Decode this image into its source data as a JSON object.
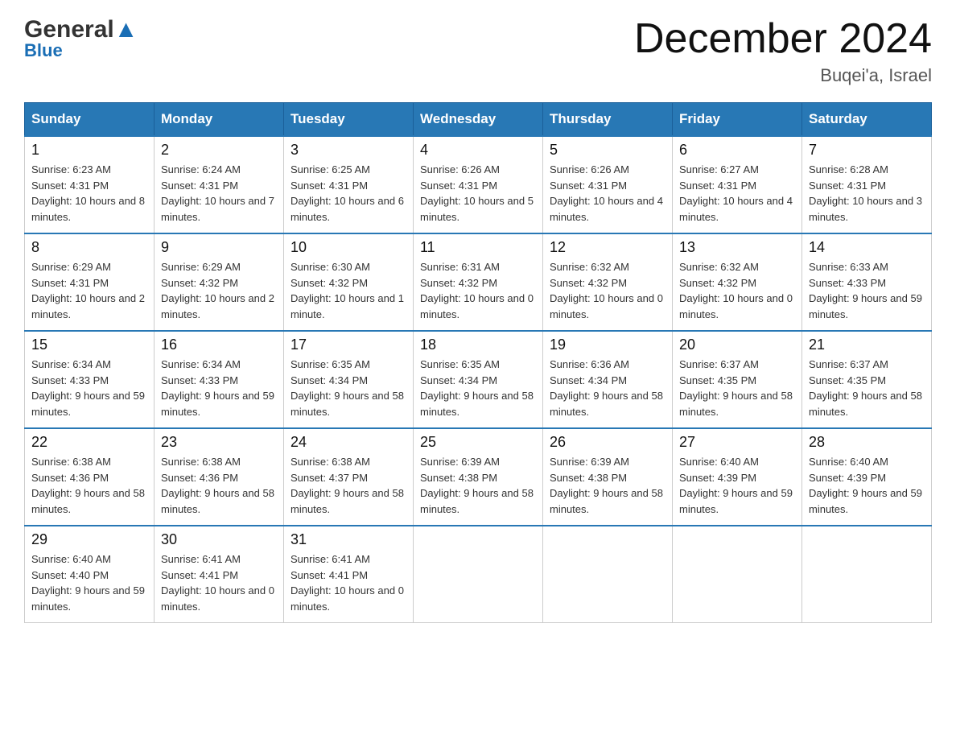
{
  "header": {
    "logo_general": "General",
    "logo_blue": "Blue",
    "title": "December 2024",
    "location": "Buqei'a, Israel"
  },
  "calendar": {
    "days_of_week": [
      "Sunday",
      "Monday",
      "Tuesday",
      "Wednesday",
      "Thursday",
      "Friday",
      "Saturday"
    ],
    "weeks": [
      [
        {
          "date": "1",
          "sunrise": "6:23 AM",
          "sunset": "4:31 PM",
          "daylight": "10 hours and 8 minutes."
        },
        {
          "date": "2",
          "sunrise": "6:24 AM",
          "sunset": "4:31 PM",
          "daylight": "10 hours and 7 minutes."
        },
        {
          "date": "3",
          "sunrise": "6:25 AM",
          "sunset": "4:31 PM",
          "daylight": "10 hours and 6 minutes."
        },
        {
          "date": "4",
          "sunrise": "6:26 AM",
          "sunset": "4:31 PM",
          "daylight": "10 hours and 5 minutes."
        },
        {
          "date": "5",
          "sunrise": "6:26 AM",
          "sunset": "4:31 PM",
          "daylight": "10 hours and 4 minutes."
        },
        {
          "date": "6",
          "sunrise": "6:27 AM",
          "sunset": "4:31 PM",
          "daylight": "10 hours and 4 minutes."
        },
        {
          "date": "7",
          "sunrise": "6:28 AM",
          "sunset": "4:31 PM",
          "daylight": "10 hours and 3 minutes."
        }
      ],
      [
        {
          "date": "8",
          "sunrise": "6:29 AM",
          "sunset": "4:31 PM",
          "daylight": "10 hours and 2 minutes."
        },
        {
          "date": "9",
          "sunrise": "6:29 AM",
          "sunset": "4:32 PM",
          "daylight": "10 hours and 2 minutes."
        },
        {
          "date": "10",
          "sunrise": "6:30 AM",
          "sunset": "4:32 PM",
          "daylight": "10 hours and 1 minute."
        },
        {
          "date": "11",
          "sunrise": "6:31 AM",
          "sunset": "4:32 PM",
          "daylight": "10 hours and 0 minutes."
        },
        {
          "date": "12",
          "sunrise": "6:32 AM",
          "sunset": "4:32 PM",
          "daylight": "10 hours and 0 minutes."
        },
        {
          "date": "13",
          "sunrise": "6:32 AM",
          "sunset": "4:32 PM",
          "daylight": "10 hours and 0 minutes."
        },
        {
          "date": "14",
          "sunrise": "6:33 AM",
          "sunset": "4:33 PM",
          "daylight": "9 hours and 59 minutes."
        }
      ],
      [
        {
          "date": "15",
          "sunrise": "6:34 AM",
          "sunset": "4:33 PM",
          "daylight": "9 hours and 59 minutes."
        },
        {
          "date": "16",
          "sunrise": "6:34 AM",
          "sunset": "4:33 PM",
          "daylight": "9 hours and 59 minutes."
        },
        {
          "date": "17",
          "sunrise": "6:35 AM",
          "sunset": "4:34 PM",
          "daylight": "9 hours and 58 minutes."
        },
        {
          "date": "18",
          "sunrise": "6:35 AM",
          "sunset": "4:34 PM",
          "daylight": "9 hours and 58 minutes."
        },
        {
          "date": "19",
          "sunrise": "6:36 AM",
          "sunset": "4:34 PM",
          "daylight": "9 hours and 58 minutes."
        },
        {
          "date": "20",
          "sunrise": "6:37 AM",
          "sunset": "4:35 PM",
          "daylight": "9 hours and 58 minutes."
        },
        {
          "date": "21",
          "sunrise": "6:37 AM",
          "sunset": "4:35 PM",
          "daylight": "9 hours and 58 minutes."
        }
      ],
      [
        {
          "date": "22",
          "sunrise": "6:38 AM",
          "sunset": "4:36 PM",
          "daylight": "9 hours and 58 minutes."
        },
        {
          "date": "23",
          "sunrise": "6:38 AM",
          "sunset": "4:36 PM",
          "daylight": "9 hours and 58 minutes."
        },
        {
          "date": "24",
          "sunrise": "6:38 AM",
          "sunset": "4:37 PM",
          "daylight": "9 hours and 58 minutes."
        },
        {
          "date": "25",
          "sunrise": "6:39 AM",
          "sunset": "4:38 PM",
          "daylight": "9 hours and 58 minutes."
        },
        {
          "date": "26",
          "sunrise": "6:39 AM",
          "sunset": "4:38 PM",
          "daylight": "9 hours and 58 minutes."
        },
        {
          "date": "27",
          "sunrise": "6:40 AM",
          "sunset": "4:39 PM",
          "daylight": "9 hours and 59 minutes."
        },
        {
          "date": "28",
          "sunrise": "6:40 AM",
          "sunset": "4:39 PM",
          "daylight": "9 hours and 59 minutes."
        }
      ],
      [
        {
          "date": "29",
          "sunrise": "6:40 AM",
          "sunset": "4:40 PM",
          "daylight": "9 hours and 59 minutes."
        },
        {
          "date": "30",
          "sunrise": "6:41 AM",
          "sunset": "4:41 PM",
          "daylight": "10 hours and 0 minutes."
        },
        {
          "date": "31",
          "sunrise": "6:41 AM",
          "sunset": "4:41 PM",
          "daylight": "10 hours and 0 minutes."
        },
        null,
        null,
        null,
        null
      ]
    ],
    "labels": {
      "sunrise": "Sunrise:",
      "sunset": "Sunset:",
      "daylight": "Daylight:"
    }
  }
}
